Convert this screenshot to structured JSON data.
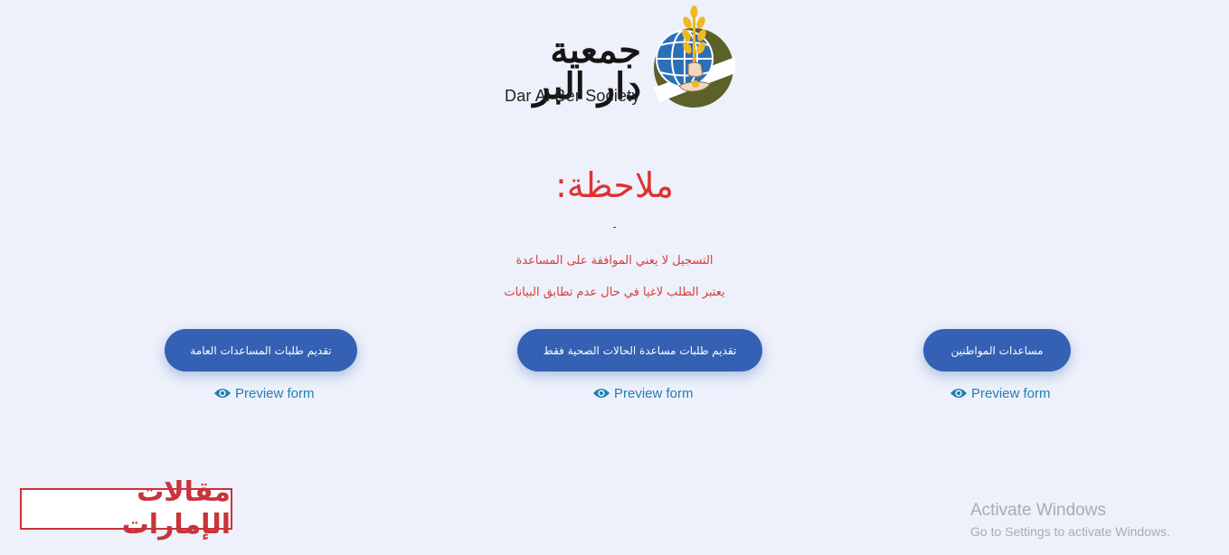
{
  "logo": {
    "arabic_name": "جمعية دار البر",
    "english_name": "Dar Al Ber Society",
    "emblem_icon": "wheat-globe-hand-icon"
  },
  "note": {
    "title": "ملاحظة:",
    "dash": "-",
    "line1": "التسجيل لا يعني الموافقة على المساعدة",
    "line2": "يعتبر الطلب لاغيا في حال عدم تطابق البيانات"
  },
  "forms": [
    {
      "label": "تقديم طلبات المساعدات العامة",
      "preview": "Preview form"
    },
    {
      "label": "تقديم طلبات مساعدة الحالات الصحية فقط",
      "preview": "Preview form"
    },
    {
      "label": "مساعدات المواطنين",
      "preview": "Preview form"
    }
  ],
  "watermark": {
    "text": "مقالات الإمارات"
  },
  "os_notice": {
    "title": "Activate Windows",
    "subtitle": "Go to Settings to activate Windows."
  },
  "colors": {
    "background": "#eef1fb",
    "button": "#3461b3",
    "note_red": "#e0312f",
    "link_blue": "#1f7fb1",
    "watermark_red": "#c9333a"
  }
}
